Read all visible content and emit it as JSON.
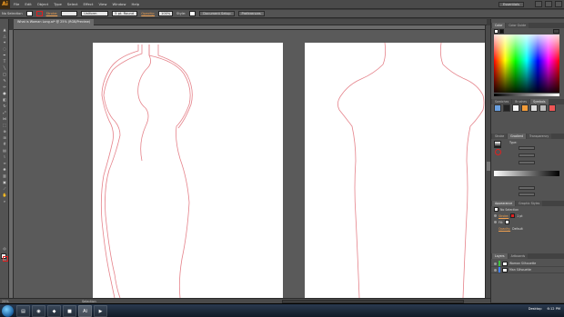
{
  "app": {
    "logo": "Ai"
  },
  "menubar": {
    "items": [
      "File",
      "Edit",
      "Object",
      "Type",
      "Select",
      "Effect",
      "View",
      "Window",
      "Help"
    ],
    "workspace": "Essentials"
  },
  "controlbar": {
    "selection": "No Selection",
    "stroke_label": "Stroke:",
    "stroke_profile": "Uniform",
    "brush": "5 pt. Round",
    "opacity_label": "Opacity:",
    "opacity_value": "100%",
    "style_label": "Style:",
    "doc_setup": "Document Setup",
    "preferences": "Preferences"
  },
  "document": {
    "tab": "What is Woman Long.ai* @ 25% (RGB/Preview)"
  },
  "statusbar": {
    "zoom": "25%",
    "message": "Selection"
  },
  "panels": {
    "color_tabs": [
      "Color",
      "Color Guide"
    ],
    "swatch_tabs": [
      "Swatches",
      "Brushes",
      "Symbols"
    ],
    "transparency_tabs": [
      "Stroke",
      "Gradient",
      "Transparency"
    ],
    "gradient_type_label": "Type:",
    "appearance_tabs": [
      "Appearance",
      "Graphic Styles"
    ],
    "appearance_title": "No Selection",
    "appearance_rows": [
      {
        "label": "Stroke:",
        "value": "1 pt"
      },
      {
        "label": "Fill:",
        "value": ""
      },
      {
        "label": "Opacity:",
        "value": "Default"
      }
    ],
    "layers_tabs": [
      "Layers",
      "Artboards"
    ],
    "layers": [
      {
        "name": "Woman Silhouette",
        "color": "#3fc23f"
      },
      {
        "name": "Man Silhouette",
        "color": "#3f7fff"
      }
    ]
  },
  "colors": {
    "stroke": "#e02020",
    "artboard": "#ffffff",
    "pasteboard": "#5a5a5a",
    "outline": "#e5828a"
  },
  "taskbar": {
    "tray_label": "Desktop",
    "time": "6:12 PM"
  }
}
